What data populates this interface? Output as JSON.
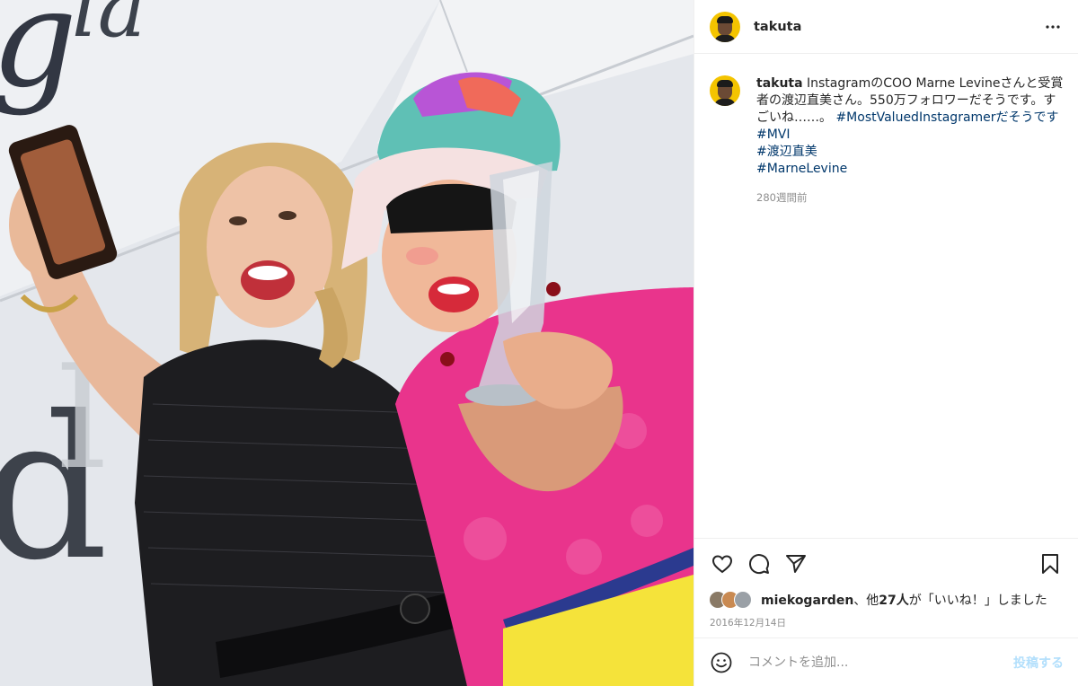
{
  "post": {
    "username": "takuta",
    "photo_alt": "Selfie photo of two women holding an award trophy"
  },
  "caption": {
    "username": "takuta",
    "text": "InstagramのCOO Marne Levineさんと受賞者の渡辺直美さん。550万フォロワーだそうです。すごいね……。",
    "inline_tag": "#MostValuedInstagramerだそうです",
    "tags": [
      "#MVI",
      "#渡辺直美",
      "#MarneLevine"
    ],
    "time": "280週間前"
  },
  "actions": {
    "like_icon": "heart-icon",
    "comment_icon": "comment-icon",
    "share_icon": "paper-plane-icon",
    "save_icon": "bookmark-icon"
  },
  "likes": {
    "user": "miekogarden",
    "text_mid": "、他",
    "others": "27人",
    "text_end": "が「いいね！」しました"
  },
  "date": "2016年12月14日",
  "comment": {
    "placeholder": "コメントを追加...",
    "post_label": "投稿する"
  },
  "colors": {
    "link": "#00376b",
    "muted": "#8e8e8e",
    "post_button_disabled": "#b2dffc",
    "avatar_bg": "#f4c400"
  }
}
